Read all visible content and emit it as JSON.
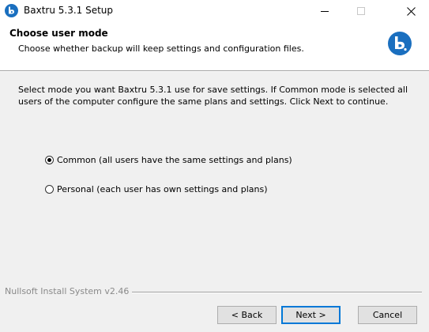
{
  "window": {
    "title": "Baxtru 5.3.1 Setup",
    "accent": "#1a6fbf"
  },
  "header": {
    "heading": "Choose user mode",
    "subheading": "Choose whether backup will keep settings and configuration files."
  },
  "body": {
    "intro": "Select mode you want Baxtru 5.3.1  use for save settings. If Common mode is selected all users of the computer configure the same plans and settings. Click Next to continue.",
    "options": [
      {
        "label": "Common (all users have the same settings and plans)",
        "selected": true
      },
      {
        "label": "Personal (each user has own settings and plans)",
        "selected": false
      }
    ]
  },
  "footer": {
    "branding": "Nullsoft Install System v2.46",
    "back_label": "< Back",
    "next_label": "Next >",
    "cancel_label": "Cancel"
  },
  "icons": {
    "app": "baxtru-app-icon",
    "logo": "baxtru-logo-icon",
    "minimize": "minimize-icon",
    "maximize": "maximize-icon",
    "close": "close-icon"
  }
}
